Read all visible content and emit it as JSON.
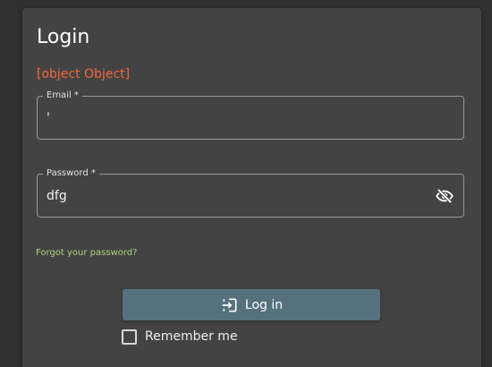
{
  "login": {
    "title": "Login",
    "error_message": "[object Object]",
    "email": {
      "label": "Email *",
      "value": "'"
    },
    "password": {
      "label": "Password *",
      "value": "dfg",
      "toggle_icon": "eye-off-icon"
    },
    "forgot_link": "Forgot your password?",
    "submit": {
      "label": "Log in",
      "icon": "login-icon"
    },
    "remember_me": {
      "label": "Remember me",
      "checked": false
    }
  },
  "colors": {
    "background": "#2f302f",
    "card": "#434343",
    "error": "#f2693b",
    "link": "#a9d37a",
    "button": "#55717d",
    "text": "#ffffff"
  }
}
